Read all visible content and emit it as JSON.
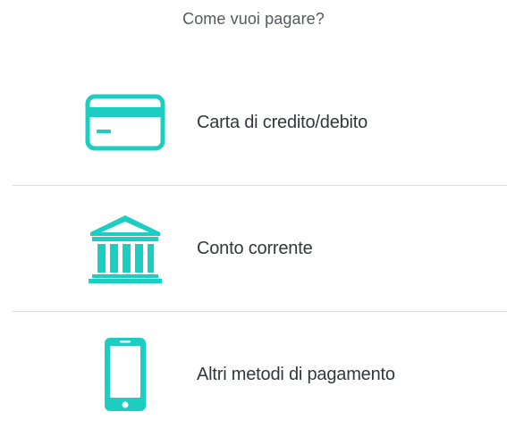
{
  "heading": "Come vuoi pagare?",
  "options": [
    {
      "label": "Carta di credito/debito",
      "icon": "credit-card-icon"
    },
    {
      "label": "Conto corrente",
      "icon": "bank-icon"
    },
    {
      "label": "Altri metodi di pagamento",
      "icon": "smartphone-icon"
    }
  ],
  "colors": {
    "accent": "#1ccdc1",
    "text": "#33373b",
    "heading": "#555a5e",
    "divider": "#dcdcdc"
  }
}
